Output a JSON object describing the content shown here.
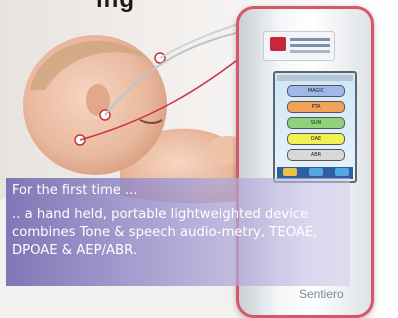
{
  "heading": "ing",
  "device": {
    "brand": "Sentiero",
    "menu": [
      "MAGIC",
      "PTA",
      "SUN",
      "OAE",
      "ABR"
    ]
  },
  "caption": {
    "headline": "For the first time ...",
    "body": ".. a hand held, portable lightweighted device combines Tone & speech audio-metry, TEOAE, DPOAE & AEP/ABR."
  },
  "colors": {
    "caption_bg": "#766cb2",
    "device_border": "#d8566a",
    "text": "#ffffff"
  }
}
